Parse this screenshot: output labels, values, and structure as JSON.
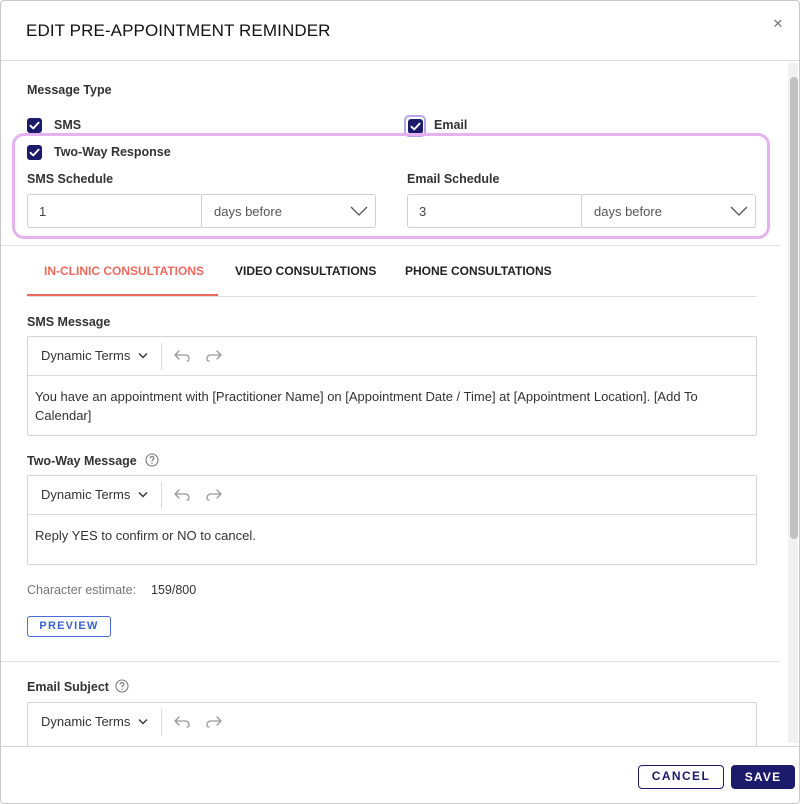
{
  "header": {
    "title": "EDIT PRE-APPOINTMENT REMINDER",
    "close_icon": "close-icon"
  },
  "message_type": {
    "label": "Message Type",
    "sms": {
      "label": "SMS",
      "checked": true
    },
    "email": {
      "label": "Email",
      "checked": true
    },
    "two_way": {
      "label": "Two-Way Response",
      "checked": true
    }
  },
  "sms_schedule": {
    "label": "SMS Schedule",
    "value": "1",
    "unit": "days before"
  },
  "email_schedule": {
    "label": "Email Schedule",
    "value": "3",
    "unit": "days before"
  },
  "tabs": [
    {
      "label": "IN-CLINIC CONSULTATIONS",
      "active": true
    },
    {
      "label": "VIDEO CONSULTATIONS",
      "active": false
    },
    {
      "label": "PHONE CONSULTATIONS",
      "active": false
    }
  ],
  "sms_message": {
    "label": "SMS Message",
    "dynamic_terms": "Dynamic Terms",
    "text": "You have an appointment with [Practitioner Name] on [Appointment Date / Time] at [Appointment Location]. [Add To Calendar]"
  },
  "two_way_message": {
    "label": "Two-Way Message",
    "dynamic_terms": "Dynamic Terms",
    "text": "Reply YES to confirm or NO to cancel."
  },
  "character_estimate": {
    "label": "Character estimate:",
    "value": "159/800"
  },
  "preview_label": "PREVIEW",
  "email_subject": {
    "label": "Email Subject",
    "dynamic_terms": "Dynamic Terms"
  },
  "footer": {
    "cancel_label": "CANCEL",
    "save_label": "SAVE"
  },
  "colors": {
    "primary": "#1c1a6b",
    "accent": "#ec6a5e",
    "highlight": "#e4b3ef",
    "link": "#3d5fd4"
  }
}
